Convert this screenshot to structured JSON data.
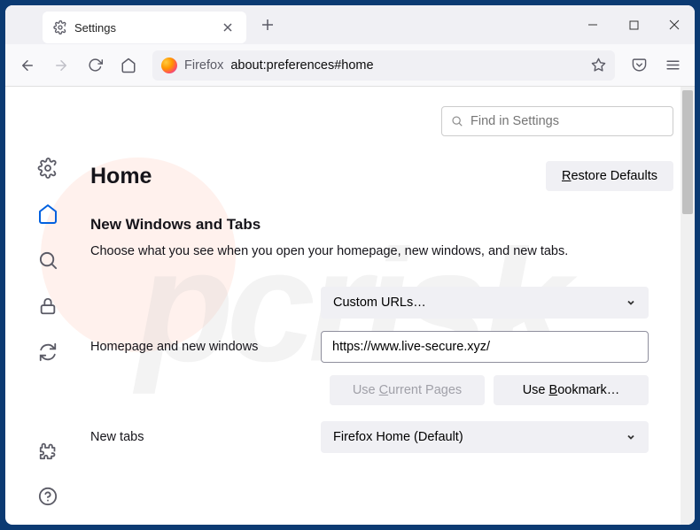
{
  "tab": {
    "title": "Settings"
  },
  "urlbar": {
    "prefix": "Firefox",
    "path": "about:preferences#home"
  },
  "search": {
    "placeholder": "Find in Settings"
  },
  "page": {
    "heading": "Home",
    "restore_btn": "Restore Defaults",
    "section_title": "New Windows and Tabs",
    "section_desc": "Choose what you see when you open your homepage, new windows, and new tabs."
  },
  "fields": {
    "homepage_label": "Homepage and new windows",
    "homepage_dropdown": "Custom URLs…",
    "homepage_url": "https://www.live-secure.xyz/",
    "use_current": "Use Current Pages",
    "use_bookmark": "Use Bookmark…",
    "newtabs_label": "New tabs",
    "newtabs_dropdown": "Firefox Home (Default)"
  }
}
